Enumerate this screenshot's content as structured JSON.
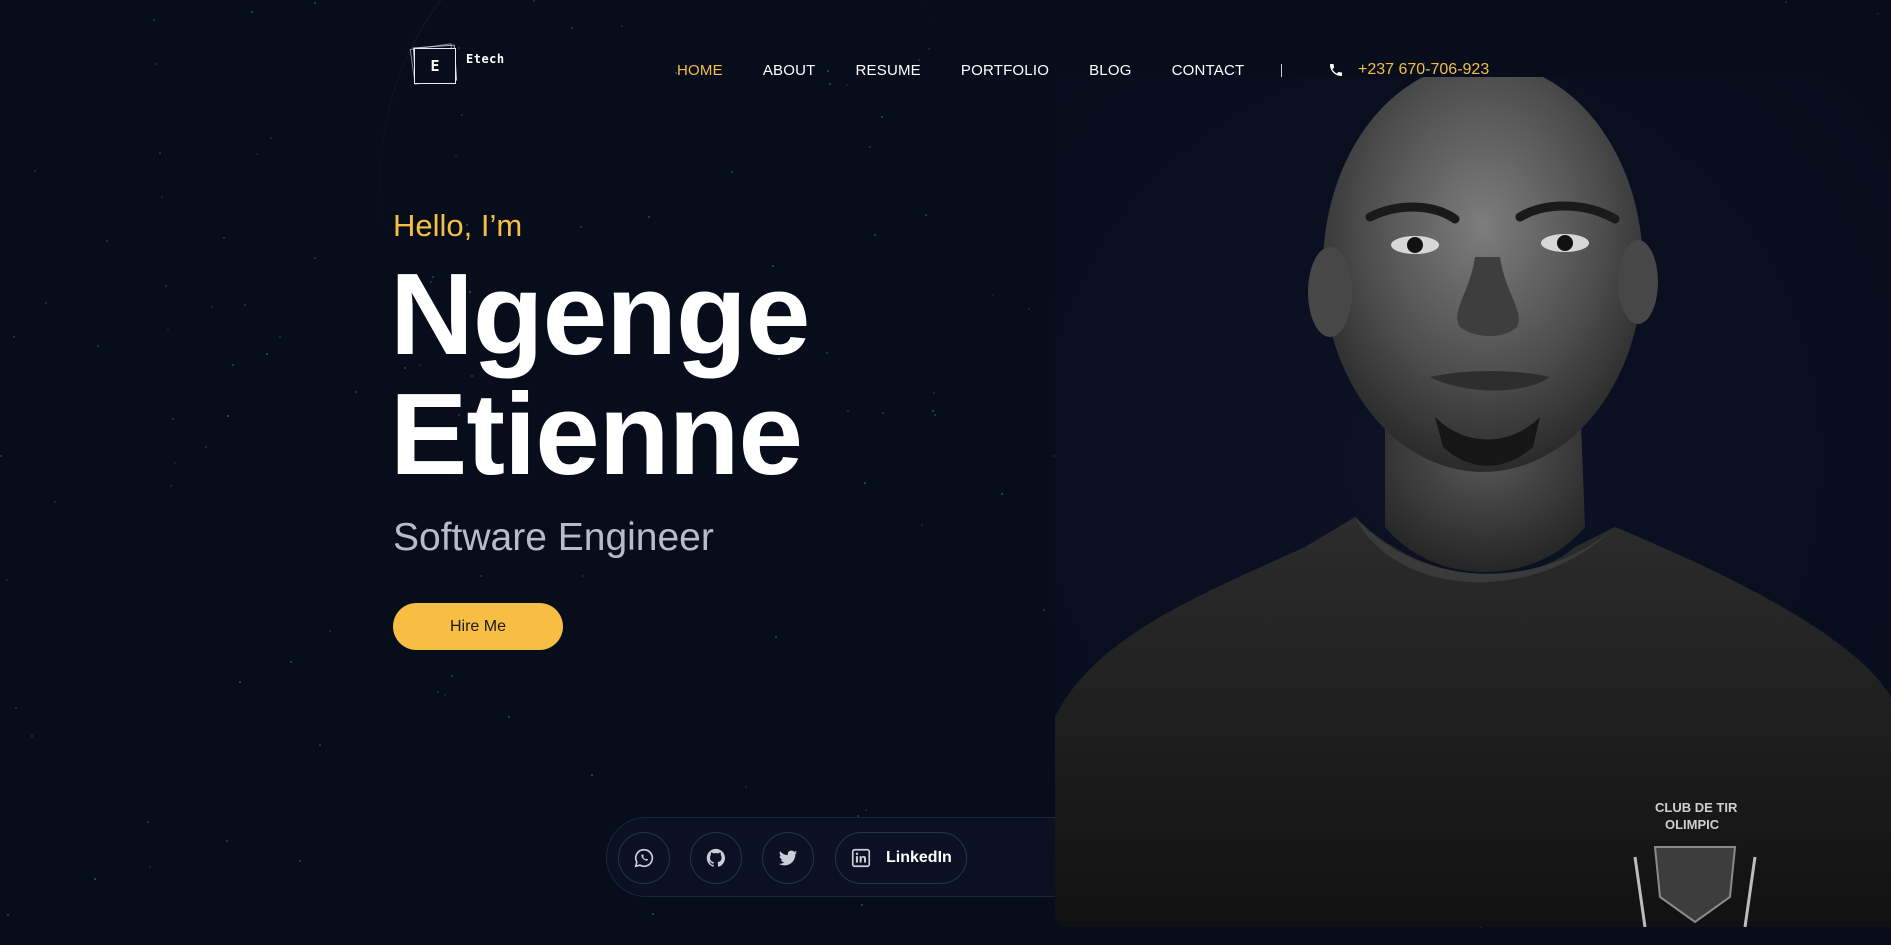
{
  "logo": {
    "letter": "E",
    "text": "Etech"
  },
  "nav": {
    "items": [
      "HOME",
      "ABOUT",
      "RESUME",
      "PORTFOLIO",
      "BLOG",
      "CONTACT"
    ],
    "active": "HOME",
    "separator": "|"
  },
  "contact": {
    "phone": "+237 670-706-923",
    "icon": "phone-icon"
  },
  "hero": {
    "greeting": "Hello, I’m",
    "first_name": "Ngenge",
    "last_name": "Etienne",
    "role": "Software Engineer",
    "cta_label": "Hire Me"
  },
  "social": {
    "items": [
      {
        "name": "whatsapp",
        "icon": "whatsapp-icon"
      },
      {
        "name": "github",
        "icon": "github-icon"
      },
      {
        "name": "twitter",
        "icon": "twitter-icon"
      },
      {
        "name": "linkedin",
        "icon": "linkedin-icon",
        "label": "LinkedIn"
      }
    ]
  },
  "portrait": {
    "description_alt": "Black and white portrait photo",
    "shirt_print": [
      "CLUB DE TIR",
      "OLIMPIC"
    ]
  },
  "colors": {
    "background": "#080d1c",
    "accent": "#f5bf45",
    "muted_text": "#b6bcc9"
  }
}
